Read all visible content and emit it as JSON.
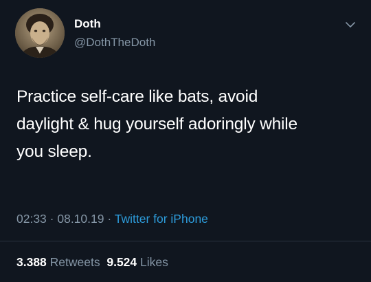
{
  "author": {
    "name": "Doth",
    "handle": "@DothTheDoth",
    "avatar_icon": "profile-avatar"
  },
  "tweet": {
    "lines": [
      "Practice self-care like bats, avoid",
      "daylight & hug yourself adoringly while",
      "you sleep."
    ]
  },
  "meta": {
    "time": "02:33",
    "separator1": " · ",
    "date": "08.10.19",
    "separator2": " · ",
    "source": "Twitter for iPhone"
  },
  "stats": {
    "retweets_count": "3.388",
    "retweets_label": "Retweets",
    "likes_count": "9.524",
    "likes_label": "Likes"
  },
  "colors": {
    "background": "#10161f",
    "text": "#ffffff",
    "muted": "#8596a6",
    "link": "#2d9cdb"
  },
  "icons": {
    "menu": "chevron-down-icon"
  }
}
